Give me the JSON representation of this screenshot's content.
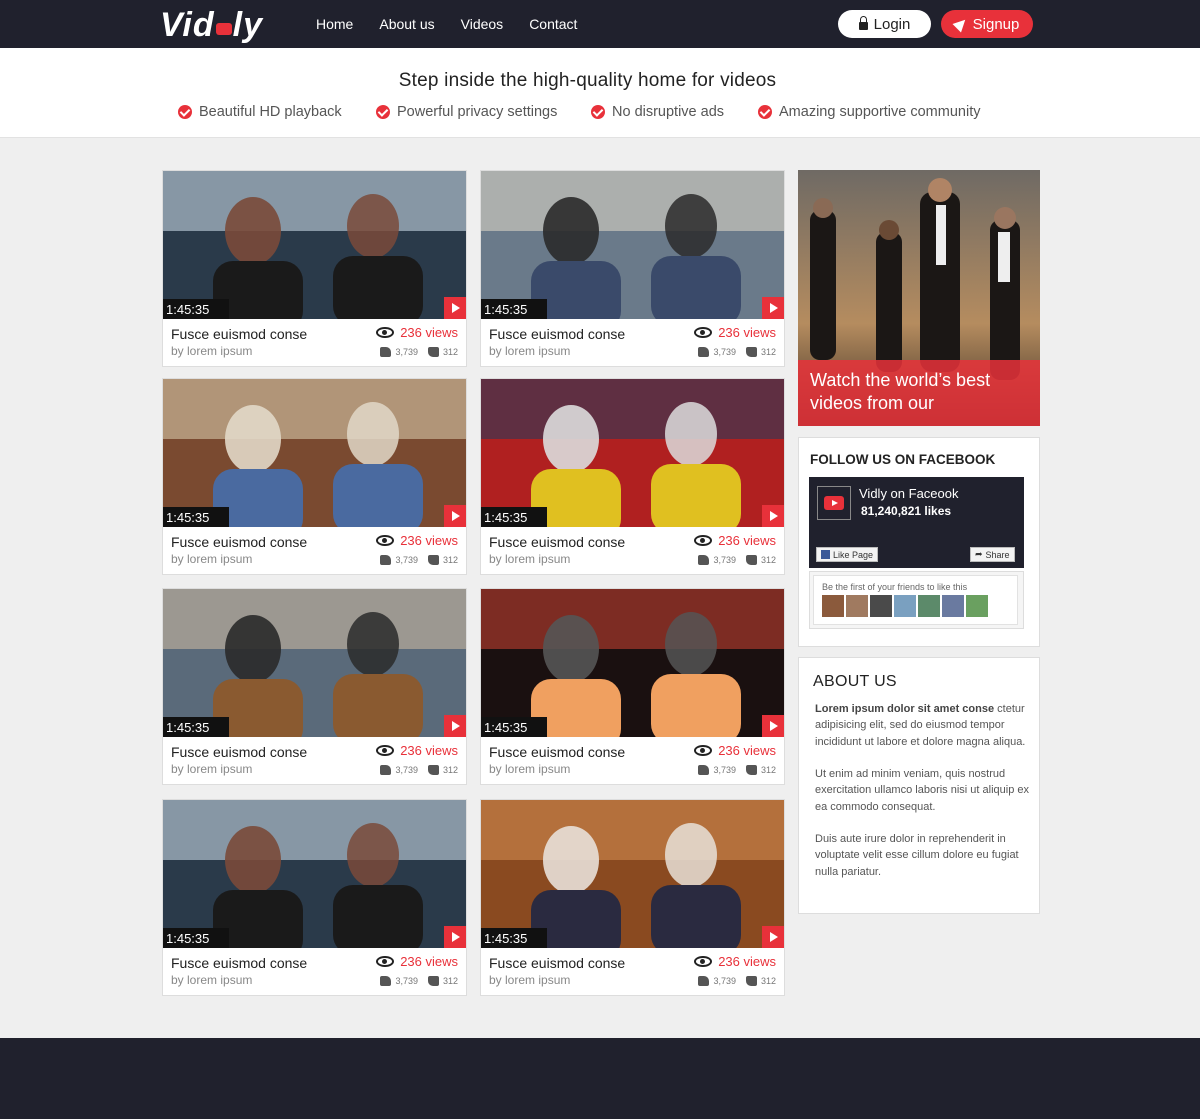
{
  "brand": {
    "logo_text": "Vidly"
  },
  "nav": {
    "items": [
      "Home",
      "About us",
      "Videos",
      "Contact"
    ]
  },
  "auth": {
    "login_label": "Login",
    "signup_label": "Signup"
  },
  "hero": {
    "headline": "Step inside the high-quality home for videos",
    "features": [
      "Beautiful HD playback",
      "Powerful privacy settings",
      "No disruptive ads",
      "Amazing supportive community"
    ]
  },
  "videos": [
    {
      "duration": "1:45:35",
      "title": "Fusce euismod conse",
      "author": "by lorem ipsum",
      "views": "236 views",
      "likes": "3,739",
      "dislikes": "312"
    },
    {
      "duration": "1:45:35",
      "title": "Fusce euismod conse",
      "author": "by lorem ipsum",
      "views": "236 views",
      "likes": "3,739",
      "dislikes": "312"
    },
    {
      "duration": "1:45:35",
      "title": "Fusce euismod conse",
      "author": "by lorem ipsum",
      "views": "236 views",
      "likes": "3,739",
      "dislikes": "312"
    },
    {
      "duration": "1:45:35",
      "title": "Fusce euismod conse",
      "author": "by lorem ipsum",
      "views": "236 views",
      "likes": "3,739",
      "dislikes": "312"
    },
    {
      "duration": "1:45:35",
      "title": "Fusce euismod conse",
      "author": "by lorem ipsum",
      "views": "236 views",
      "likes": "3,739",
      "dislikes": "312"
    },
    {
      "duration": "1:45:35",
      "title": "Fusce euismod conse",
      "author": "by lorem ipsum",
      "views": "236 views",
      "likes": "3,739",
      "dislikes": "312"
    },
    {
      "duration": "1:45:35",
      "title": "Fusce euismod conse",
      "author": "by lorem ipsum",
      "views": "236 views",
      "likes": "3,739",
      "dislikes": "312"
    },
    {
      "duration": "1:45:35",
      "title": "Fusce euismod conse",
      "author": "by lorem ipsum",
      "views": "236 views",
      "likes": "3,739",
      "dislikes": "312"
    }
  ],
  "promo": {
    "caption": "Watch the world’s best videos from our"
  },
  "facebook": {
    "heading": "FOLLOW US ON FACEBOOK",
    "page_name": "Vidly on Faceook",
    "likes": "81,240,821 likes",
    "like_button": "Like Page",
    "share_button": "Share",
    "friends_text": "Be the first of your friends to like this"
  },
  "about": {
    "heading": "ABOUT US",
    "lead_bold": "Lorem ipsum dolor sit amet conse",
    "lead_rest": " ctetur adipisicing elit, sed do eiusmod tempor incididunt ut labore et dolore magna aliqua.",
    "p2": "Ut enim ad minim veniam, quis nostrud exercitation ullamco laboris nisi ut aliquip ex ea commodo consequat.",
    "p3": "Duis aute irure dolor in reprehenderit in voluptate velit esse cillum dolore eu fugiat nulla pariatur."
  },
  "colors": {
    "accent": "#e8313a",
    "dark": "#20212d",
    "background": "#efefef"
  }
}
